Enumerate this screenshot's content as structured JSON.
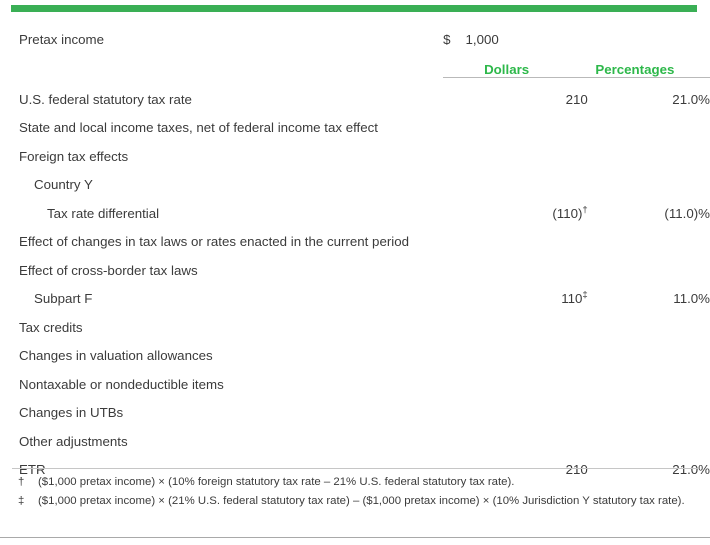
{
  "header_bar_color": "#3aaf55",
  "accent_color": "#2db84a",
  "text_color": "#3b3b3b",
  "table": {
    "columns": {
      "label": "",
      "currency_symbol": "$",
      "dollars": "Dollars",
      "percentages": "Percentages"
    },
    "pretax_row": {
      "label": "Pretax income",
      "currency": "$",
      "amount": "1,000"
    },
    "rows": [
      {
        "label": "U.S. federal statutory tax rate",
        "indent": 0,
        "dollars": "210",
        "dollars_note": "",
        "percentages": "21.0%"
      },
      {
        "label": "State and local income taxes, net of federal income tax effect",
        "indent": 0,
        "dollars": "",
        "dollars_note": "",
        "percentages": ""
      },
      {
        "label": "Foreign tax effects",
        "indent": 0,
        "dollars": "",
        "dollars_note": "",
        "percentages": ""
      },
      {
        "label": "Country Y",
        "indent": 1,
        "dollars": "",
        "dollars_note": "",
        "percentages": ""
      },
      {
        "label": "Tax rate differential",
        "indent": 2,
        "dollars": "(110)",
        "dollars_note": "†",
        "percentages": "(11.0)%"
      },
      {
        "label": "Effect of changes in tax laws or rates enacted in the current period",
        "indent": 0,
        "dollars": "",
        "dollars_note": "",
        "percentages": ""
      },
      {
        "label": "Effect of cross-border tax laws",
        "indent": 0,
        "dollars": "",
        "dollars_note": "",
        "percentages": ""
      },
      {
        "label": "Subpart F",
        "indent": 1,
        "dollars": "110",
        "dollars_note": "‡",
        "percentages": "11.0%"
      },
      {
        "label": "Tax credits",
        "indent": 0,
        "dollars": "",
        "dollars_note": "",
        "percentages": ""
      },
      {
        "label": "Changes in valuation allowances",
        "indent": 0,
        "dollars": "",
        "dollars_note": "",
        "percentages": ""
      },
      {
        "label": "Nontaxable or nondeductible items",
        "indent": 0,
        "dollars": "",
        "dollars_note": "",
        "percentages": ""
      },
      {
        "label": "Changes in UTBs",
        "indent": 0,
        "dollars": "",
        "dollars_note": "",
        "percentages": ""
      },
      {
        "label": "Other adjustments",
        "indent": 0,
        "dollars": "",
        "dollars_note": "",
        "percentages": ""
      },
      {
        "label": "ETR",
        "indent": 0,
        "dollars": "210",
        "dollars_note": "",
        "percentages": "21.0%"
      }
    ]
  },
  "footnotes": [
    {
      "mark": "†",
      "text": "($1,000 pretax income) × (10% foreign statutory tax rate – 21% U.S. federal statutory tax rate)."
    },
    {
      "mark": "‡",
      "text": "($1,000 pretax income) × (21% U.S. federal statutory tax rate) – ($1,000 pretax income) × (10% Jurisdiction Y statutory tax rate)."
    }
  ]
}
